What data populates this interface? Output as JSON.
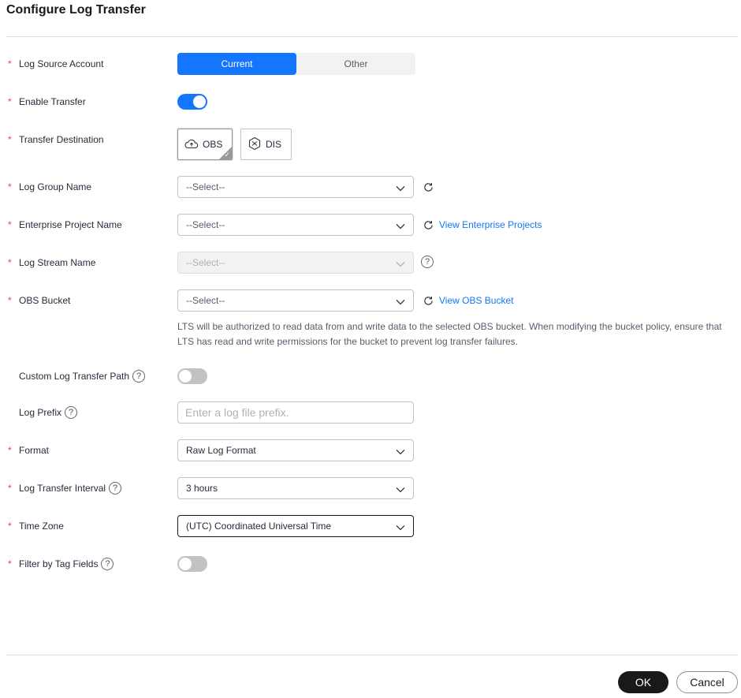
{
  "dialog": {
    "title": "Configure Log Transfer"
  },
  "form": {
    "log_source_account": {
      "label": "Log Source Account",
      "options": [
        "Current",
        "Other"
      ],
      "selected": "Current"
    },
    "enable_transfer": {
      "label": "Enable Transfer",
      "on": true
    },
    "transfer_destination": {
      "label": "Transfer Destination",
      "options": [
        "OBS",
        "DIS"
      ],
      "selected": "OBS"
    },
    "log_group": {
      "label": "Log Group Name",
      "value": "--Select--"
    },
    "enterprise_project": {
      "label": "Enterprise Project Name",
      "value": "--Select--",
      "link": "View Enterprise Projects"
    },
    "log_stream": {
      "label": "Log Stream Name",
      "value": "--Select--",
      "disabled": true
    },
    "obs_bucket": {
      "label": "OBS Bucket",
      "value": "--Select--",
      "link": "View OBS Bucket",
      "hint": "LTS will be authorized to read data from and write data to the selected OBS bucket. When modifying the bucket policy, ensure that LTS has read and write permissions for the bucket to prevent log transfer failures."
    },
    "custom_path": {
      "label": "Custom Log Transfer Path",
      "on": false
    },
    "log_prefix": {
      "label": "Log Prefix",
      "value": "",
      "placeholder": "Enter a log file prefix."
    },
    "format": {
      "label": "Format",
      "value": "Raw Log Format"
    },
    "interval": {
      "label": "Log Transfer Interval",
      "value": "3 hours"
    },
    "time_zone": {
      "label": "Time Zone",
      "value": "(UTC) Coordinated Universal Time"
    },
    "filter_tags": {
      "label": "Filter by Tag Fields",
      "on": false
    }
  },
  "footer": {
    "ok_label": "OK",
    "cancel_label": "Cancel"
  },
  "colors": {
    "accent": "#1476ff",
    "required": "#e54545",
    "primary_button": "#191919"
  },
  "icons": {
    "refresh": "refresh-icon",
    "help": "help-icon",
    "chevron": "chevron-down-icon",
    "obs": "cloud-upload-icon",
    "dis": "dis-hexagon-icon"
  }
}
